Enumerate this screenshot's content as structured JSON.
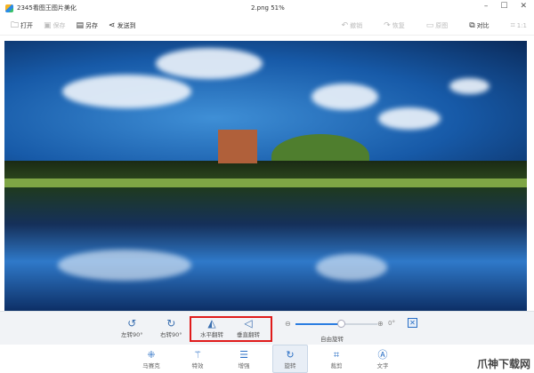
{
  "window": {
    "app_title": "2345看图王图片美化",
    "file_title": "2.png   51%",
    "minimize": "–",
    "maximize": "☐",
    "close": "✕"
  },
  "toolbar": {
    "open": "打开",
    "save": "保存",
    "save_as": "另存",
    "send_to": "发送到",
    "undo": "撤销",
    "redo": "恢复",
    "original": "原图",
    "compare": "对比",
    "one_to_one": "1:1"
  },
  "rotate_panel": {
    "rotate_left": "左转90°",
    "rotate_right": "右转90°",
    "flip_horizontal": "水平翻转",
    "flip_vertical": "垂直翻转",
    "free_rotate": "自由旋转",
    "angle": "0°",
    "slider_fraction": 0.55,
    "highlight_color": "#e01b1b"
  },
  "bottom_tools": [
    {
      "label": "马赛克",
      "icon": "mosaic-icon"
    },
    {
      "label": "特效",
      "icon": "magic-wand-icon"
    },
    {
      "label": "增强",
      "icon": "sliders-icon"
    },
    {
      "label": "旋转",
      "icon": "rotate-icon",
      "active": true
    },
    {
      "label": "裁剪",
      "icon": "crop-icon"
    },
    {
      "label": "文字",
      "icon": "text-icon"
    }
  ],
  "watermark": "爪神下载网"
}
